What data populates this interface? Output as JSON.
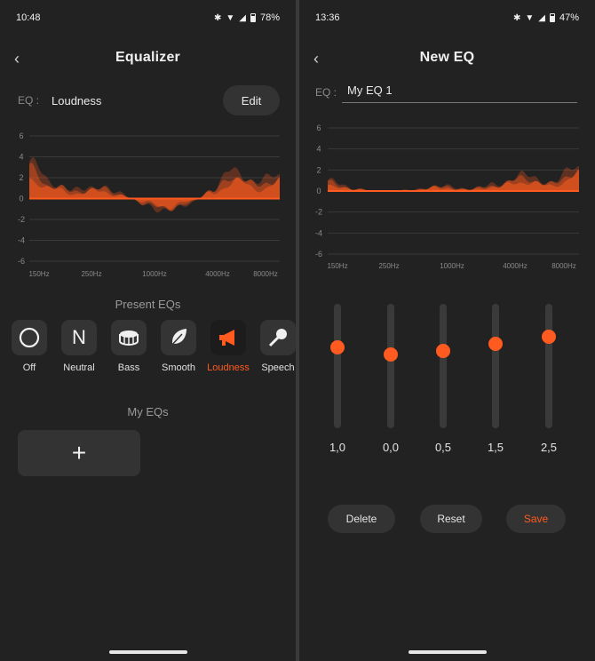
{
  "left": {
    "status": {
      "time": "10:48",
      "battery": "78%"
    },
    "title": "Equalizer",
    "eq": {
      "label": "EQ :",
      "value": "Loudness",
      "edit_label": "Edit"
    },
    "chart_data": {
      "type": "area",
      "y_ticks": [
        "6",
        "4",
        "2",
        "0",
        "-2",
        "-4",
        "-6"
      ],
      "ylim": [
        -6,
        6
      ],
      "x_ticks": [
        "150Hz",
        "250Hz",
        "1000Hz",
        "4000Hz",
        "8000Hz"
      ],
      "series": [
        {
          "values": [
            3.5,
            1.5,
            0.8,
            1.2,
            0.5,
            -0.5,
            -1.3,
            -0.5,
            0.8,
            2.8,
            1.5,
            2.5
          ]
        }
      ],
      "color": "#ff5a1f"
    },
    "presets_title": "Present EQs",
    "presets": [
      {
        "label": "Off",
        "icon": "circle-icon"
      },
      {
        "label": "Neutral",
        "icon": "n-letter-icon"
      },
      {
        "label": "Bass",
        "icon": "drum-icon"
      },
      {
        "label": "Smooth",
        "icon": "feather-icon"
      },
      {
        "label": "Loudness",
        "icon": "megaphone-icon"
      },
      {
        "label": "Speech",
        "icon": "microphone-icon"
      }
    ],
    "myeqs_title": "My EQs",
    "add_label": "+"
  },
  "right": {
    "status": {
      "time": "13:36",
      "battery": "47%"
    },
    "title": "New EQ",
    "eq": {
      "label": "EQ :",
      "value": "My EQ 1"
    },
    "chart_data": {
      "type": "area",
      "y_ticks": [
        "6",
        "4",
        "2",
        "0",
        "-2",
        "-4",
        "-6"
      ],
      "ylim": [
        -6,
        6
      ],
      "x_ticks": [
        "150Hz",
        "250Hz",
        "1000Hz",
        "4000Hz",
        "8000Hz"
      ],
      "series": [
        {
          "values": [
            1.0,
            0.2,
            0.0,
            0.1,
            0.5,
            0.2,
            0.6,
            1.5,
            0.8,
            2.5
          ]
        }
      ],
      "color": "#ff5a1f"
    },
    "sliders": [
      {
        "value": 1.0,
        "label": "1,0"
      },
      {
        "value": 0.0,
        "label": "0,0"
      },
      {
        "value": 0.5,
        "label": "0,5"
      },
      {
        "value": 1.5,
        "label": "1,5"
      },
      {
        "value": 2.5,
        "label": "2,5"
      }
    ],
    "buttons": {
      "delete": "Delete",
      "reset": "Reset",
      "save": "Save"
    }
  },
  "colors": {
    "accent": "#ff5a1f",
    "background": "#222222",
    "surface": "#333333"
  }
}
